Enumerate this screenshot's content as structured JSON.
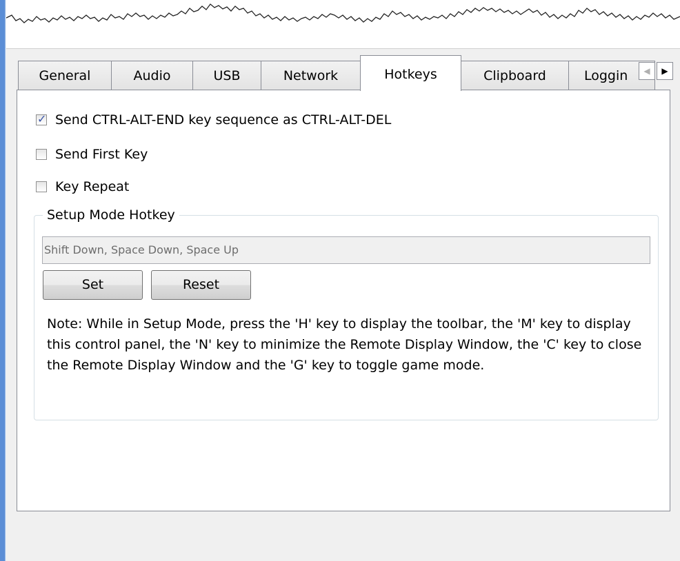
{
  "tabs": [
    {
      "label": "General"
    },
    {
      "label": "Audio"
    },
    {
      "label": "USB"
    },
    {
      "label": "Network"
    },
    {
      "label": "Hotkeys",
      "active": true
    },
    {
      "label": "Clipboard"
    },
    {
      "label": "Loggin"
    }
  ],
  "tab_scroll": {
    "left_icon": "chevron-left-icon",
    "right_icon": "chevron-right-icon"
  },
  "options": {
    "ctrl_alt_end": {
      "label": "Send CTRL-ALT-END key sequence as CTRL-ALT-DEL",
      "checked": true
    },
    "send_first_key": {
      "label": "Send First Key",
      "checked": false
    },
    "key_repeat": {
      "label": "Key Repeat",
      "checked": false
    }
  },
  "setup_mode": {
    "title": "Setup Mode Hotkey",
    "hotkey_value": "Shift Down, Space Down, Space Up",
    "set_label": "Set",
    "reset_label": "Reset",
    "note": "Note: While in Setup Mode, press the 'H' key to display the toolbar, the 'M' key to display this control panel, the 'N' key to minimize the Remote Display Window, the 'C' key to close the Remote Display Window and the 'G' key to toggle game mode."
  },
  "colors": {
    "window_border": "#5b8ed6",
    "dialog_bg": "#f0f0f0",
    "check_mark": "#3a55a8"
  }
}
